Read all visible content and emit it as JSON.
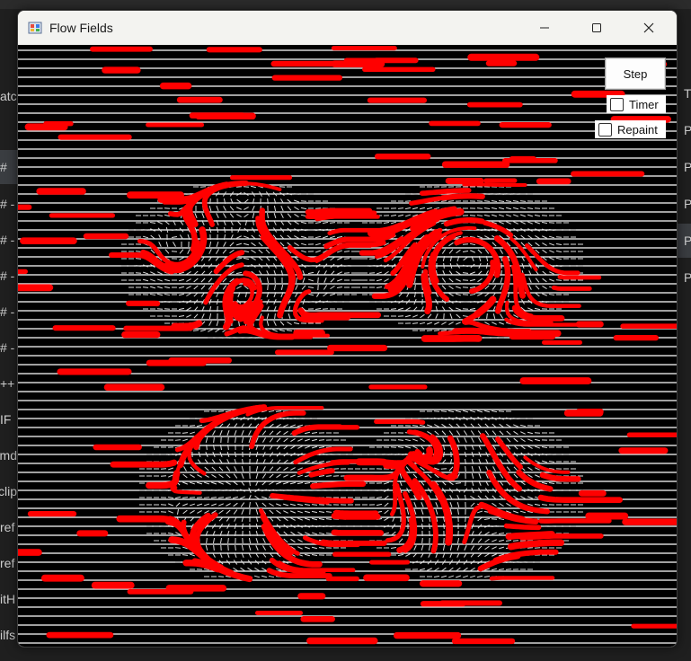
{
  "window": {
    "title": "Flow Fields",
    "icon": "flow-fields-app-icon",
    "caption_buttons": {
      "minimize": "—",
      "maximize": "☐",
      "close": "✕"
    }
  },
  "controls": {
    "step_label": "Step",
    "timer_label": "Timer",
    "timer_checked": false,
    "repaint_label": "Repaint",
    "repaint_checked": false
  },
  "canvas": {
    "background": "#000000",
    "grid_line_color": "#ffffff",
    "streak_color": "#ff0000"
  },
  "background_ide": {
    "left_fragments": [
      "atc",
      "#",
      "# -",
      "# -",
      "# -",
      "# -",
      "# -",
      "++",
      "IF",
      "md",
      "clip",
      "ref",
      "ref",
      "itH",
      "ilfs"
    ],
    "right_fragments": [
      "T",
      "P",
      "P",
      "P",
      "P",
      "P"
    ]
  }
}
